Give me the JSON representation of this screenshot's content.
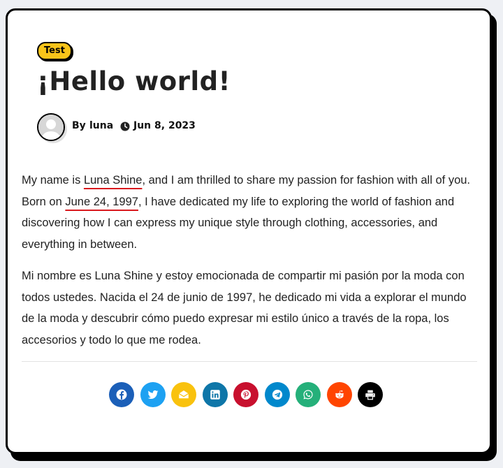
{
  "post": {
    "category": "Test",
    "title": "¡Hello world!",
    "by_label": "By",
    "author": "luna",
    "date": "Jun 8, 2023",
    "p1": {
      "t1": "My name is ",
      "name": "Luna Shine",
      "t2": ", and I am thrilled to share my passion for fashion with all of you. Born on ",
      "birth": "June 24, 1997",
      "t3": ", I have dedicated my life to exploring the world of fashion and discovering how I can express my unique style through clothing, accessories, and everything in between."
    },
    "p2": "Mi nombre es Luna Shine y estoy emocionada de compartir mi pasión por la moda con todos ustedes. Nacida el 24 de junio de 1997, he dedicado mi vida a explorar el mundo de la moda y descubrir cómo puedo expresar mi estilo único a través de la ropa, los accesorios y todo lo que me rodea."
  },
  "share": [
    {
      "icon": "facebook-icon",
      "color": "#1b5fb8"
    },
    {
      "icon": "twitter-icon",
      "color": "#1da1f2"
    },
    {
      "icon": "email-icon",
      "color": "#f9c20e"
    },
    {
      "icon": "linkedin-icon",
      "color": "#0e76a8"
    },
    {
      "icon": "pinterest-icon",
      "color": "#c8102e"
    },
    {
      "icon": "telegram-icon",
      "color": "#0088cc"
    },
    {
      "icon": "whatsapp-icon",
      "color": "#25b07a"
    },
    {
      "icon": "reddit-icon",
      "color": "#ff4500"
    },
    {
      "icon": "print-icon",
      "color": "#000000"
    }
  ]
}
